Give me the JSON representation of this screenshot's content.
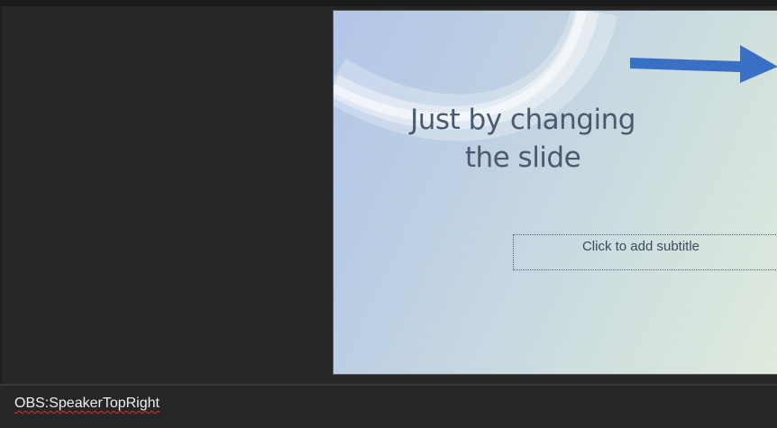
{
  "slide": {
    "title_line1": "Just by changing",
    "title_line2": "the slide",
    "subtitle_placeholder": "Click to add subtitle"
  },
  "notes": {
    "text": "OBS:SpeakerTopRight"
  },
  "colors": {
    "background": "#262626",
    "slide_gradient_start": "#b3c6e8",
    "slide_gradient_end": "#dfeadb",
    "arrow": "#3a6fc6"
  },
  "icons": {
    "arrow": "right-arrow-icon"
  }
}
